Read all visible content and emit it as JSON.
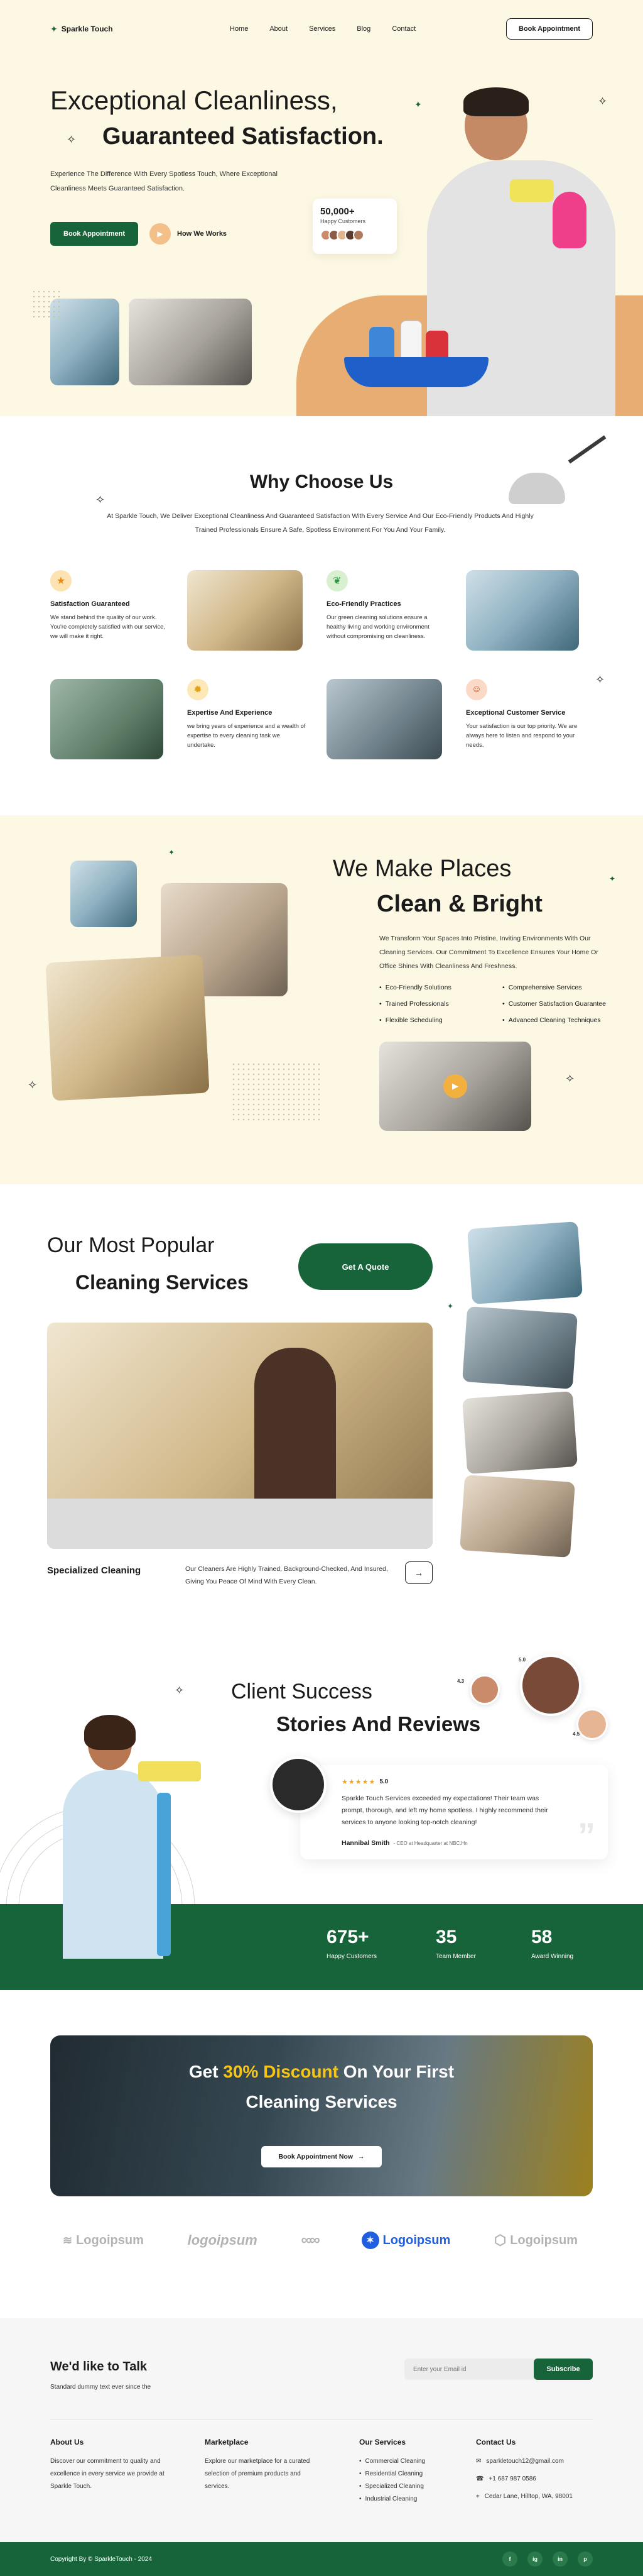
{
  "nav": {
    "brand": "Sparkle Touch",
    "links": [
      "Home",
      "About",
      "Services",
      "Blog",
      "Contact"
    ],
    "cta": "Book Appointment"
  },
  "hero": {
    "title_line1": "Exceptional Cleanliness,",
    "title_line2": "Guaranteed Satisfaction.",
    "subtitle": "Experience The Difference With Every Spotless Touch, Where Exceptional Cleanliness Meets Guaranteed Satisfaction.",
    "primary_cta": "Book Appointment",
    "secondary_cta": "How We Works",
    "customers_count": "50,000+",
    "customers_label": "Happy Customers"
  },
  "why": {
    "title": "Why Choose Us",
    "subtitle": "At Sparkle Touch, We Deliver Exceptional Cleanliness And Guaranteed Satisfaction With Every Service And Our Eco-Friendly Products And Highly Trained Professionals Ensure A Safe, Spotless Environment For You And Your Family.",
    "features": [
      {
        "title": "Satisfaction Guaranteed",
        "text": "We stand behind the quality of our work. You're completely satisfied with our service, we will make it right."
      },
      {
        "title": "Eco-Friendly Practices",
        "text": "Our green cleaning solutions ensure a healthy living and working environment without compromising on cleanliness."
      },
      {
        "title": "Expertise And Experience",
        "text": "we bring years of experience and a wealth of expertise to every cleaning task we undertake."
      },
      {
        "title": "Exceptional Customer Service",
        "text": "Your satisfaction is our top priority. We are always here to listen and respond to your needs."
      }
    ]
  },
  "clean": {
    "title_line1": "We Make Places",
    "title_line2": "Clean & Bright",
    "text": "We Transform Your Spaces Into Pristine, Inviting Environments With Our Cleaning Services. Our Commitment To Excellence Ensures Your Home Or Office Shines With Cleanliness And Freshness.",
    "bullets": [
      "Eco-Friendly Solutions",
      "Comprehensive Services",
      "Trained Professionals",
      "Customer Satisfaction Guarantee",
      "Flexible Scheduling",
      "Advanced Cleaning Techniques"
    ]
  },
  "services": {
    "title_line1": "Our Most Popular",
    "title_line2": "Cleaning Services",
    "cta": "Get A Quote",
    "featured_title": "Specialized Cleaning",
    "featured_text": "Our Cleaners Are Highly Trained, Background-Checked, And Insured, Giving You Peace Of Mind With Every Clean."
  },
  "reviews": {
    "title_line1": "Client Success",
    "title_line2": "Stories And Reviews",
    "stars": "★★★★★",
    "rating": "5.0",
    "quote": "Sparkle Touch Services exceeded my expectations! Their team was prompt, thorough, and left my home spotless. I highly recommend their services to anyone looking top-notch cleaning!",
    "author": "Hannibal Smith",
    "author_role": "- CEO at Headquarter at NBC.Hn",
    "badge1": "4.3",
    "badge2": "5.0",
    "badge3": "4.5"
  },
  "stats": [
    {
      "value": "675+",
      "label": "Happy Customers"
    },
    {
      "value": "35",
      "label": "Team Member"
    },
    {
      "value": "58",
      "label": "Award Winning"
    }
  ],
  "promo": {
    "prefix": "Get ",
    "highlight": "30% Discount",
    "suffix": " On Your First",
    "line2": "Cleaning Services",
    "cta": "Book Appointment Now"
  },
  "logos": [
    "Logoipsum",
    "logoipsum",
    "Logoipsum",
    "Logoipsum"
  ],
  "newsletter": {
    "title": "We'd like to Talk",
    "subtitle": "Standard dummy text ever since the",
    "placeholder": "Enter your Email id",
    "button": "Subscribe"
  },
  "footer": {
    "about_title": "About Us",
    "about_text": "Discover our commitment to quality and excellence in every service we provide at Sparkle Touch.",
    "market_title": "Marketplace",
    "market_text": "Explore our marketplace for a curated selection of premium products and services.",
    "services_title": "Our Services",
    "services": [
      "Commercial Cleaning",
      "Residential Cleaning",
      "Specialized Cleaning",
      "Industrial Cleaning"
    ],
    "contact_title": "Contact Us",
    "email": "sparkletouch12@gmail.com",
    "phone": "+1 687 987 0586",
    "address": "Cedar Lane, Hilltop, WA, 98001",
    "copyright": "Copyright By © SparkleTouch - 2024",
    "social": [
      "f",
      "ig",
      "in",
      "p"
    ]
  },
  "colors": {
    "brand_green": "#17643a",
    "cream": "#fdf8e3",
    "accent_orange": "#f0a050",
    "discount_yellow": "#f5c518"
  }
}
